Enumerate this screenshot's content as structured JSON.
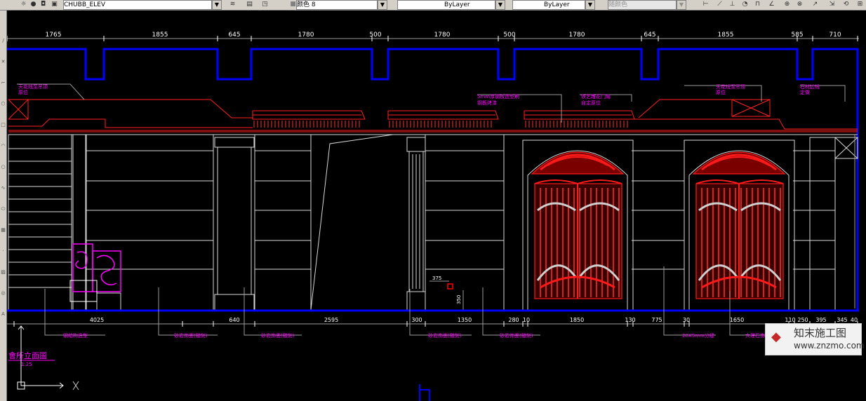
{
  "toolbar": {
    "layer_name": "CHUBB_ELEV",
    "color_label": "颜色 8",
    "linetype": "ByLayer",
    "lineweight": "ByLayer",
    "plotstyle": "随颜色"
  },
  "dims_top": [
    "1765",
    "1855",
    "645",
    "1780",
    "500",
    "1780",
    "500",
    "1780",
    "645",
    "1855",
    "585",
    "710"
  ],
  "dims_bottom": [
    "4025",
    "640",
    "2595",
    "300",
    "1350",
    "280",
    "10",
    "1850",
    "130",
    "775",
    "30",
    "1650",
    "110",
    "250",
    "395",
    "345",
    "40"
  ],
  "dim_small": [
    "375",
    "350"
  ],
  "notes_top_left": [
    "天花线至吊顶",
    "原位"
  ],
  "notes_top_mid_a": [
    "5mm厚钢板造型刷",
    "钢板烤漆"
  ],
  "notes_top_mid_b": [
    "铁艺雕花门扇",
    "自定原位"
  ],
  "notes_top_right_a": [
    "天花线至吊顶",
    "原位"
  ],
  "notes_top_right_b": [
    "石材边线",
    "定做"
  ],
  "notes_bottom": [
    "钢结构造型",
    "砂岩饰面(雕刻)",
    "砂岩饰面(雕刻)",
    "砂岩饰面(雕刻)",
    "砂岩饰面(雕刻)",
    "20X5mm分缝",
    "大理石饰面"
  ],
  "view_title": "會所立面圖",
  "view_scale": "1:25",
  "watermark": {
    "logo": "◆",
    "name": "知末施工图",
    "url": "www.znzmo.com"
  },
  "colors": {
    "blue": "#0000ff",
    "red": "#ff0000",
    "magenta": "#ff00ff",
    "white": "#ffffff",
    "grey": "#9a9a9a"
  }
}
